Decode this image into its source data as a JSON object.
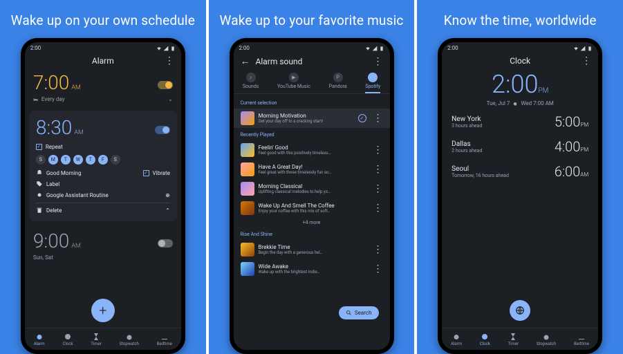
{
  "headlines": [
    "Wake up on your own schedule",
    "Wake up to your favorite music",
    "Know the time, worldwide"
  ],
  "status_time": "2:00",
  "s1": {
    "title": "Alarm",
    "a1": {
      "time": "7:00",
      "ampm": "AM",
      "sub": "Every day"
    },
    "a2": {
      "time": "8:30",
      "ampm": "AM",
      "repeat": "Repeat",
      "days": [
        "S",
        "M",
        "T",
        "W",
        "T",
        "F",
        "S"
      ],
      "sound": "Good Morning",
      "vibrate": "Vibrate",
      "label": "Label",
      "routine": "Google Assistant Routine",
      "delete": "Delete"
    },
    "a3": {
      "time": "9:00",
      "ampm": "AM",
      "sub": "Sun, Sat"
    }
  },
  "s2": {
    "title": "Alarm sound",
    "tabs": [
      "Sounds",
      "YouTube Music",
      "Pandora",
      "Spotify"
    ],
    "sec1": "Current selection",
    "current": {
      "t": "Morning Motivation",
      "s": "Get your day off to a cracking start!"
    },
    "sec2": "Recently Played",
    "recent": [
      {
        "t": "Feelin' Good",
        "s": "Feel good with this positively timeless…"
      },
      {
        "t": "Have A Great Day!",
        "s": "Feel great with these timelessly fun so…"
      },
      {
        "t": "Morning Classical",
        "s": "Uplifting classical melodies to help yo…"
      },
      {
        "t": "Wake Up And Smell The Coffee",
        "s": "Enjoy your coffee with this mix of soft…"
      }
    ],
    "more": "+4 more",
    "sec3": "Rise And Shine",
    "rise": [
      {
        "t": "Brekkie Time",
        "s": "Begin the day with a generous hel…"
      },
      {
        "t": "Wide Awake",
        "s": "Wake up with the brightest Indie…"
      }
    ],
    "search": "Search"
  },
  "s3": {
    "title": "Clock",
    "time": "2:00",
    "ampm": "PM",
    "date_left": "Tue, Jul 7",
    "date_right": "Wed 7:00 AM",
    "world": [
      {
        "city": "New York",
        "off": "3 hours ahead",
        "t": "5:00",
        "ampm": "PM"
      },
      {
        "city": "Dallas",
        "off": "2 hours ahead",
        "t": "4:00",
        "ampm": "PM"
      },
      {
        "city": "Seoul",
        "off": "Tomorrow, 16 hours ahead",
        "t": "6:00",
        "ampm": "AM"
      }
    ]
  },
  "nav": [
    "Alarm",
    "Clock",
    "Timer",
    "Stopwatch",
    "Bedtime"
  ]
}
